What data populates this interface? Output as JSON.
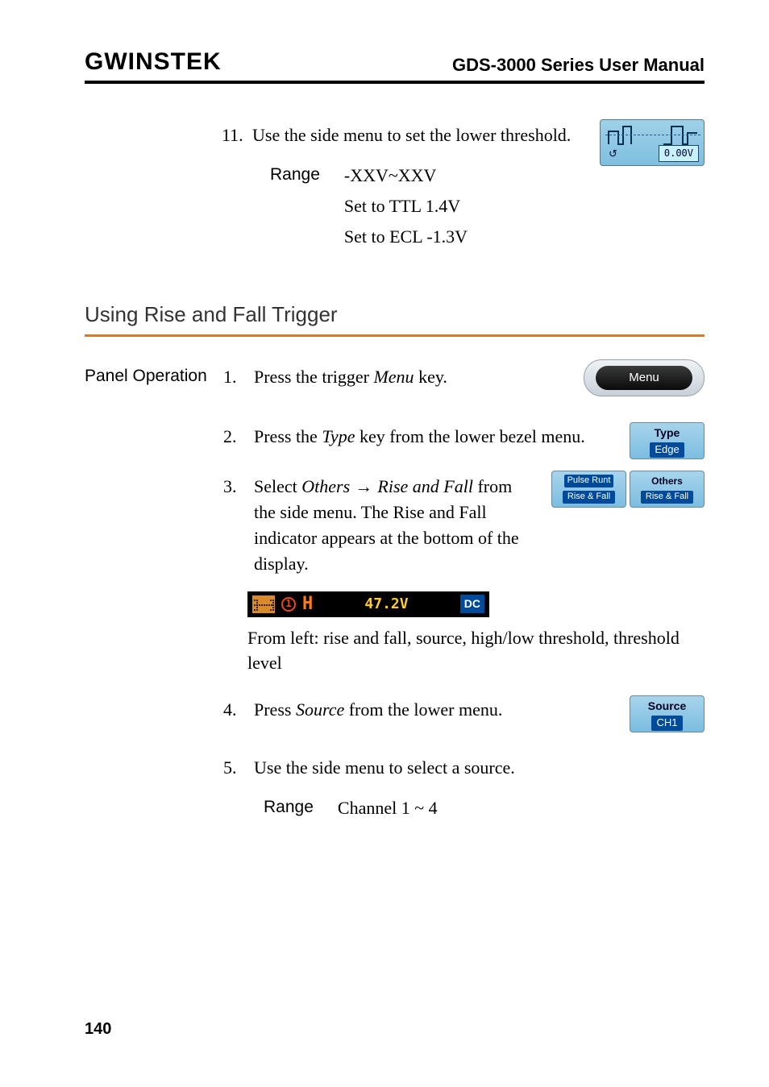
{
  "header": {
    "logo": "GWINSTEK",
    "doc_title": "GDS-3000 Series User Manual"
  },
  "step11": {
    "number": "11.",
    "text": "Use the side menu to set the lower threshold.",
    "icon_value": "0.00V",
    "rotate_glyph": "↺"
  },
  "range11": {
    "label": "Range",
    "line1": "-XXV~XXV",
    "line2": "Set to TTL 1.4V",
    "line3": "Set to ECL -1.3V"
  },
  "section": {
    "heading": "Using Rise and Fall Trigger"
  },
  "panel_op_label": "Panel Operation",
  "step1": {
    "number": "1.",
    "text_a": "Press the trigger ",
    "text_b": "Menu",
    "text_c": " key.",
    "btn_label": "Menu"
  },
  "step2": {
    "number": "2.",
    "text_a": "Press the ",
    "text_b": "Type",
    "text_c": " key from the lower bezel menu.",
    "btn_l1": "Type",
    "btn_l2": "Edge"
  },
  "step3": {
    "number": "3.",
    "text_a": "Select ",
    "text_b": "Others",
    "arrow": " → ",
    "text_c": "Rise and Fall",
    "text_d": " from the side menu. The Rise and Fall indicator appears at the bottom of the display.",
    "btnA_l1": "Pulse Runt",
    "btnA_l2": "Rise & Fall",
    "btnB_l1": "Others",
    "btnB_l2": "Rise & Fall",
    "indicator": {
      "circle": "1",
      "h": "H",
      "value": "47.2V",
      "dc": "DC"
    },
    "caption": "From left: rise and fall, source, high/low threshold, threshold level"
  },
  "step4": {
    "number": "4.",
    "text_a": "Press ",
    "text_b": "Source",
    "text_c": " from the lower menu.",
    "btn_l1": "Source",
    "btn_l2": "CH1"
  },
  "step5": {
    "number": "5.",
    "text": "Use the side menu to select a source.",
    "range_label": "Range",
    "range_value": "Channel 1 ~ 4"
  },
  "page_number": "140"
}
